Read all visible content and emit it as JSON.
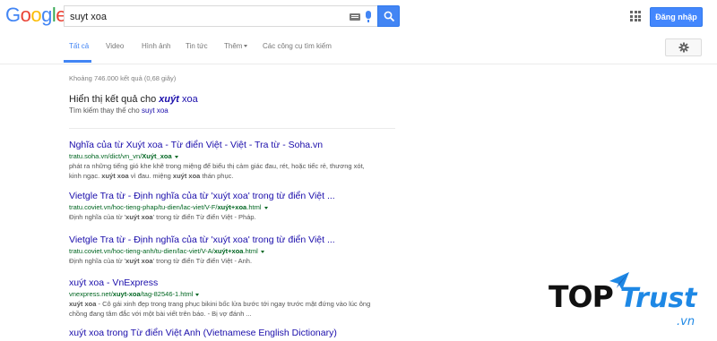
{
  "logo": {
    "g1": "G",
    "o1": "o",
    "o2": "o",
    "g2": "g",
    "l": "l",
    "e": "e"
  },
  "search": {
    "value": "suyt xoa"
  },
  "header": {
    "signin_label": "Đăng nhập"
  },
  "tabs": [
    {
      "label": "Tất cả",
      "active": true
    },
    {
      "label": "Video"
    },
    {
      "label": "Hình ảnh"
    },
    {
      "label": "Tin tức"
    },
    {
      "label": "Thêm"
    },
    {
      "label": "Các công cụ tìm kiếm"
    }
  ],
  "stats": "Khoảng 746.000 kết quả (0,68 giây)",
  "spelling": {
    "showing_prefix": "Hiển thị kết quả cho",
    "corrected_bold": "xuýt",
    "corrected_rest": " xoa",
    "instead_prefix": "Tìm kiếm thay thế cho",
    "original": "suyt xoa"
  },
  "results": [
    {
      "title": "Nghĩa của từ Xuýt xoa - Từ điển Việt - Việt - Tra từ - Soha.vn",
      "url_prefix": "tratu.soha.vn/dict/vn_vn/",
      "url_bold": "Xuýt_xoa",
      "snippet1": "phát ra những tiếng gió khe khẽ trong miệng để biểu thị cảm giác đau, rét, hoặc tiếc rẻ, thương xót,",
      "snippet2_a": "kinh ngạc. ",
      "snippet2_bold": "xuýt xoa",
      "snippet2_b": " vì đau. miệng ",
      "snippet2_bold2": "xuýt xoa",
      "snippet2_c": " thán phục."
    },
    {
      "title": "Vietgle Tra từ - Định nghĩa của từ 'xuýt xoa' trong từ điển Việt ...",
      "url_prefix": "tratu.coviet.vn/hoc-tieng-phap/tu-dien/lac-viet/V-F/",
      "url_bold": "xuýt+xoa",
      "url_suffix": ".html",
      "snippet_a": "Định nghĩa của từ '",
      "snippet_bold": "xuýt xoa",
      "snippet_b": "' trong từ điển Từ điển Việt - Pháp."
    },
    {
      "title": "Vietgle Tra từ - Định nghĩa của từ 'xuýt xoa' trong từ điển Việt ...",
      "url_prefix": "tratu.coviet.vn/hoc-tieng-anh/tu-dien/lac-viet/V-A/",
      "url_bold": "xuýt+xoa",
      "url_suffix": ".html",
      "snippet_a": "Định nghĩa của từ '",
      "snippet_bold": "xuýt xoa",
      "snippet_b": "' trong từ điển Từ điển Việt - Anh."
    },
    {
      "title": "xuýt xoa - VnExpress",
      "url_prefix": "vnexpress.net/",
      "url_bold": "xuyt-xoa",
      "url_suffix": "/tag-82546-1.html",
      "snippet_bold": "xuýt xoa",
      "snippet1_rest": " - Cô gái xinh đẹp trong trang phục bikini bốc lửa bước tới ngay trước mặt đứng vào lúc ông",
      "snippet2": "chồng đang tâm đắc với một bài viết trên báo. - Bị vợ đánh ..."
    },
    {
      "title": "xuýt xoa trong Từ điển Việt Anh (Vietnamese English Dictionary)"
    }
  ],
  "watermark": {
    "top": "TOP",
    "trust": "Trust",
    "vn": ".vn"
  },
  "colors": {
    "link": "#1a0dab",
    "url": "#006621",
    "accent": "#4285f4",
    "snippet": "#545454"
  }
}
